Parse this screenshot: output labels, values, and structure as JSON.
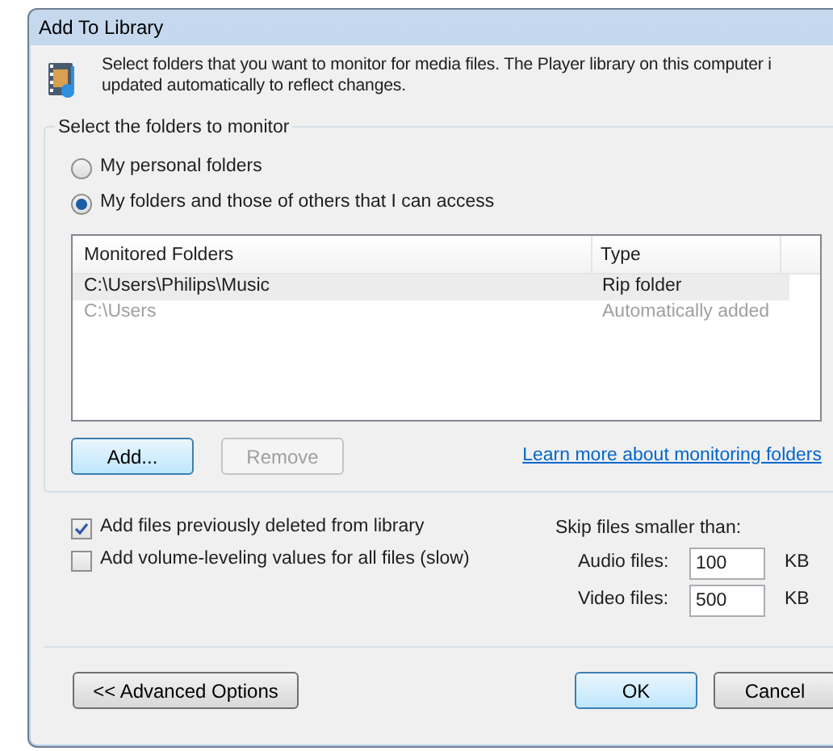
{
  "window": {
    "title": "Add To Library"
  },
  "description": [
    "Select folders that you want to monitor for media files. The Player library on this computer i",
    "updated automatically to reflect changes."
  ],
  "group": {
    "title": "Select the folders to monitor",
    "options": [
      {
        "label": "My personal folders",
        "selected": false
      },
      {
        "label": "My folders and those of others that I can access",
        "selected": true
      }
    ],
    "table": {
      "columns": [
        "Monitored Folders",
        "Type"
      ],
      "rows": [
        {
          "cells": [
            "C:\\Users\\Philips\\Music",
            "Rip folder"
          ],
          "selected": true,
          "disabled": false
        },
        {
          "cells": [
            "C:\\Users",
            "Automatically added"
          ],
          "selected": false,
          "disabled": true
        }
      ]
    },
    "buttons": [
      {
        "label": "Add...",
        "default": true,
        "disabled": false
      },
      {
        "label": "Remove",
        "default": false,
        "disabled": true
      }
    ],
    "link": "Learn more about monitoring folders"
  },
  "checkboxes": [
    {
      "label": "Add files previously deleted from library",
      "checked": true
    },
    {
      "label": "Add volume-leveling values for all files (slow)",
      "checked": false
    }
  ],
  "skip": {
    "title": "Skip files smaller than:",
    "fields": [
      {
        "label": "Audio files:",
        "value": "100",
        "unit": "KB"
      },
      {
        "label": "Video files:",
        "value": "500",
        "unit": "KB"
      }
    ]
  },
  "footer": {
    "left": {
      "label": "<< Advanced Options",
      "default": false,
      "disabled": false
    },
    "right": [
      {
        "label": "OK",
        "default": true,
        "disabled": false
      },
      {
        "label": "Cancel",
        "default": false,
        "disabled": false
      }
    ]
  }
}
